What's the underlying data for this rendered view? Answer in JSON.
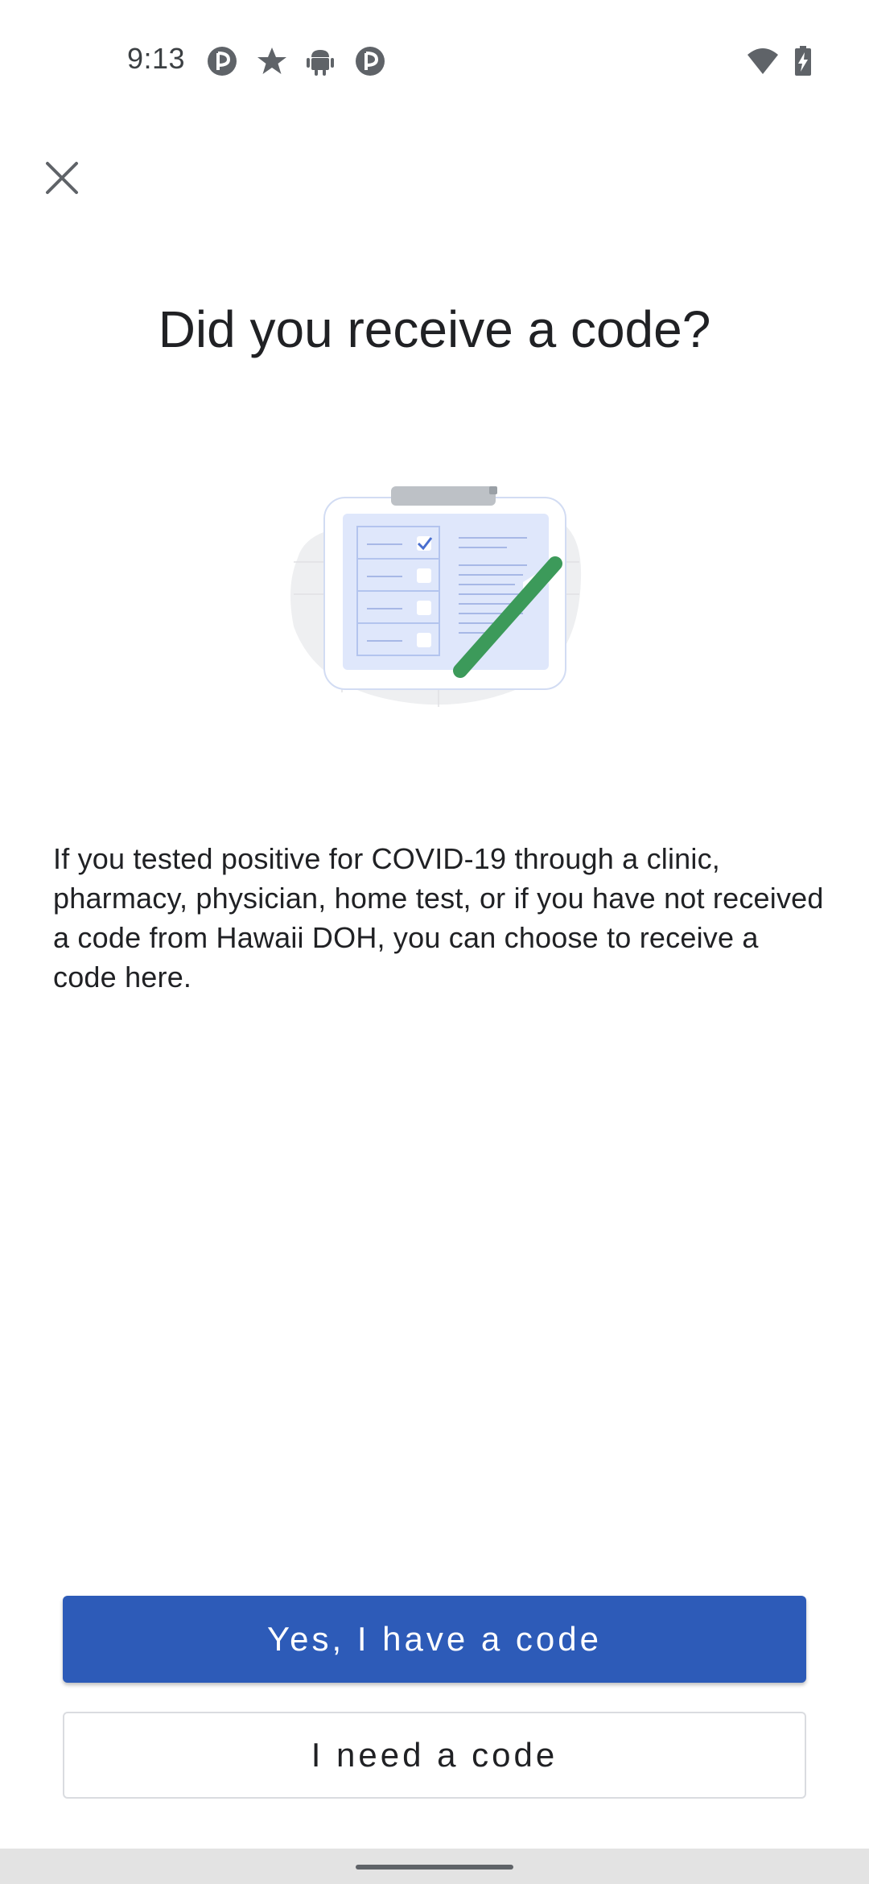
{
  "status_bar": {
    "time": "9:13",
    "left_icons": [
      "pinterest-like-icon",
      "star-icon",
      "android-icon",
      "pinterest-like-icon"
    ],
    "right_icons": [
      "wifi-icon",
      "battery-charging-icon"
    ]
  },
  "header": {
    "close_icon": "close-icon"
  },
  "main": {
    "title": "Did you receive a code?",
    "description": "If you tested positive for COVID-19 through a clinic, pharmacy, physician, home test, or if you have not received a code from Hawaii DOH, you can choose to receive a code here."
  },
  "actions": {
    "primary_label": "Yes, I have a code",
    "secondary_label": "I need a code"
  },
  "colors": {
    "primary": "#2d5bb8",
    "illustration_green": "#3c9a5a",
    "illustration_blue": "#dfe7fb"
  }
}
